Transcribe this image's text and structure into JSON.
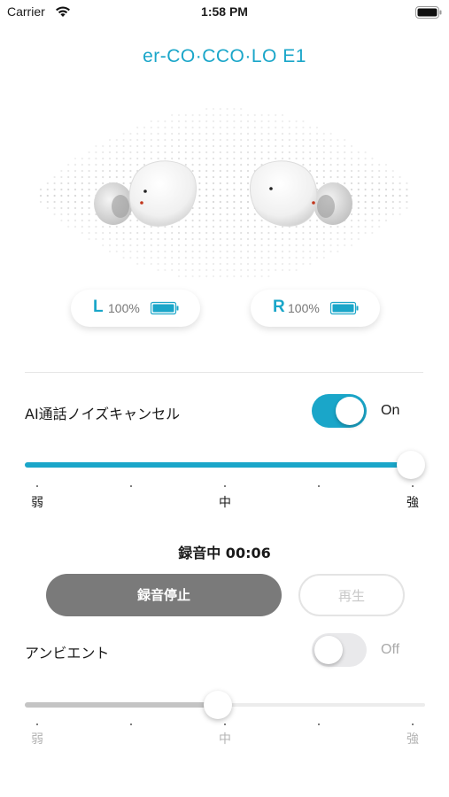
{
  "status_bar": {
    "carrier": "Carrier",
    "time": "1:58 PM"
  },
  "device": {
    "name": "er-CO·CCO·LO E1"
  },
  "earbuds": {
    "left": {
      "side": "L",
      "battery": "100%",
      "battery_level": 1.0
    },
    "right": {
      "side": "R",
      "battery": "100%",
      "battery_level": 1.0
    }
  },
  "noise_cancel": {
    "label": "AI通話ノイズキャンセル",
    "enabled": true,
    "state_label": "On",
    "level": 1.0,
    "scale": {
      "min": "弱",
      "mid": "中",
      "max": "強"
    }
  },
  "recording": {
    "status": "録音中 00:06",
    "stop_label": "録音停止",
    "play_label": "再生"
  },
  "ambient": {
    "label": "アンビエント",
    "enabled": false,
    "state_label": "Off",
    "level": 0.5,
    "scale": {
      "min": "弱",
      "mid": "中",
      "max": "強"
    }
  },
  "colors": {
    "accent": "#1aa6c9",
    "stop_button": "#7a7a7a",
    "toggle_off": "#e9e9eb"
  }
}
